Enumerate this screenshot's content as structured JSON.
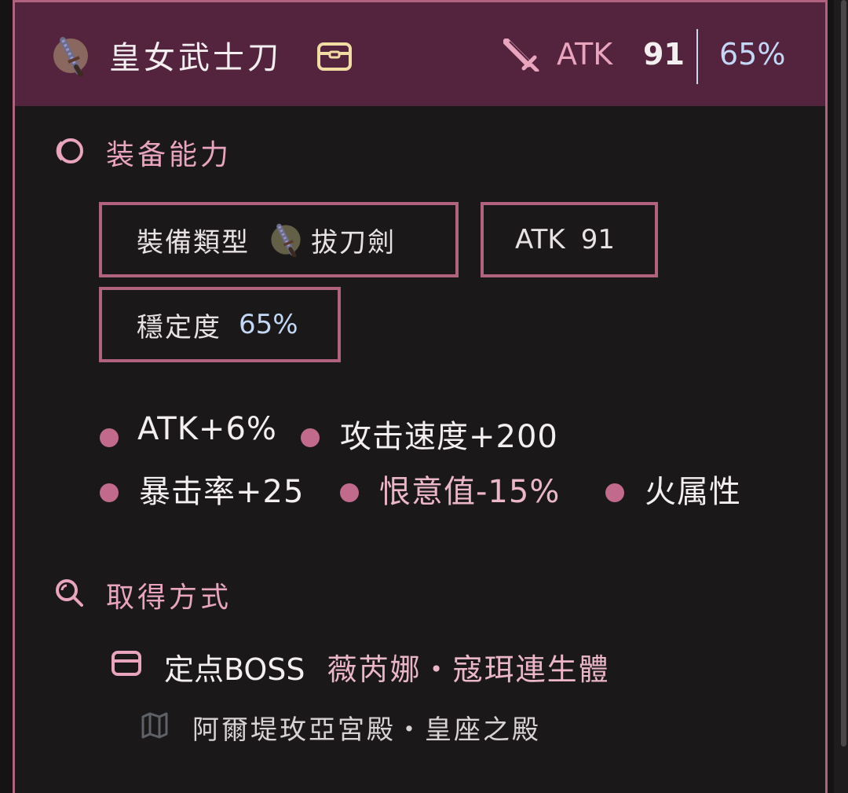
{
  "header": {
    "weapon_name": "皇女武士刀",
    "atk_label": "ATK",
    "atk_value": "91",
    "stability_value": "65%",
    "icons": [
      "katana-icon",
      "chest-icon",
      "sword-icon"
    ]
  },
  "ability": {
    "title": "装备能力",
    "type_label": "裝備類型",
    "type_value": "拔刀劍",
    "atk_label": "ATK",
    "atk_value": "91",
    "stability_label": "穩定度",
    "stability_value": "65%",
    "stats": [
      {
        "text": "ATK+6%"
      },
      {
        "text": "攻击速度+200"
      },
      {
        "text": "暴击率+25"
      },
      {
        "text": "恨意值-15%"
      },
      {
        "text": "火属性"
      }
    ]
  },
  "acquire": {
    "title": "取得方式",
    "source_type": "定点BOSS",
    "boss_name": "薇芮娜・寇珥連生體",
    "location": "阿爾堤玫亞宮殿・皇座之殿"
  },
  "colors": {
    "accent": "#b0627f",
    "header_bg": "#54243e",
    "pink_text": "#e9a4be",
    "blue_text": "#c2d8f6",
    "background": "#151314"
  }
}
